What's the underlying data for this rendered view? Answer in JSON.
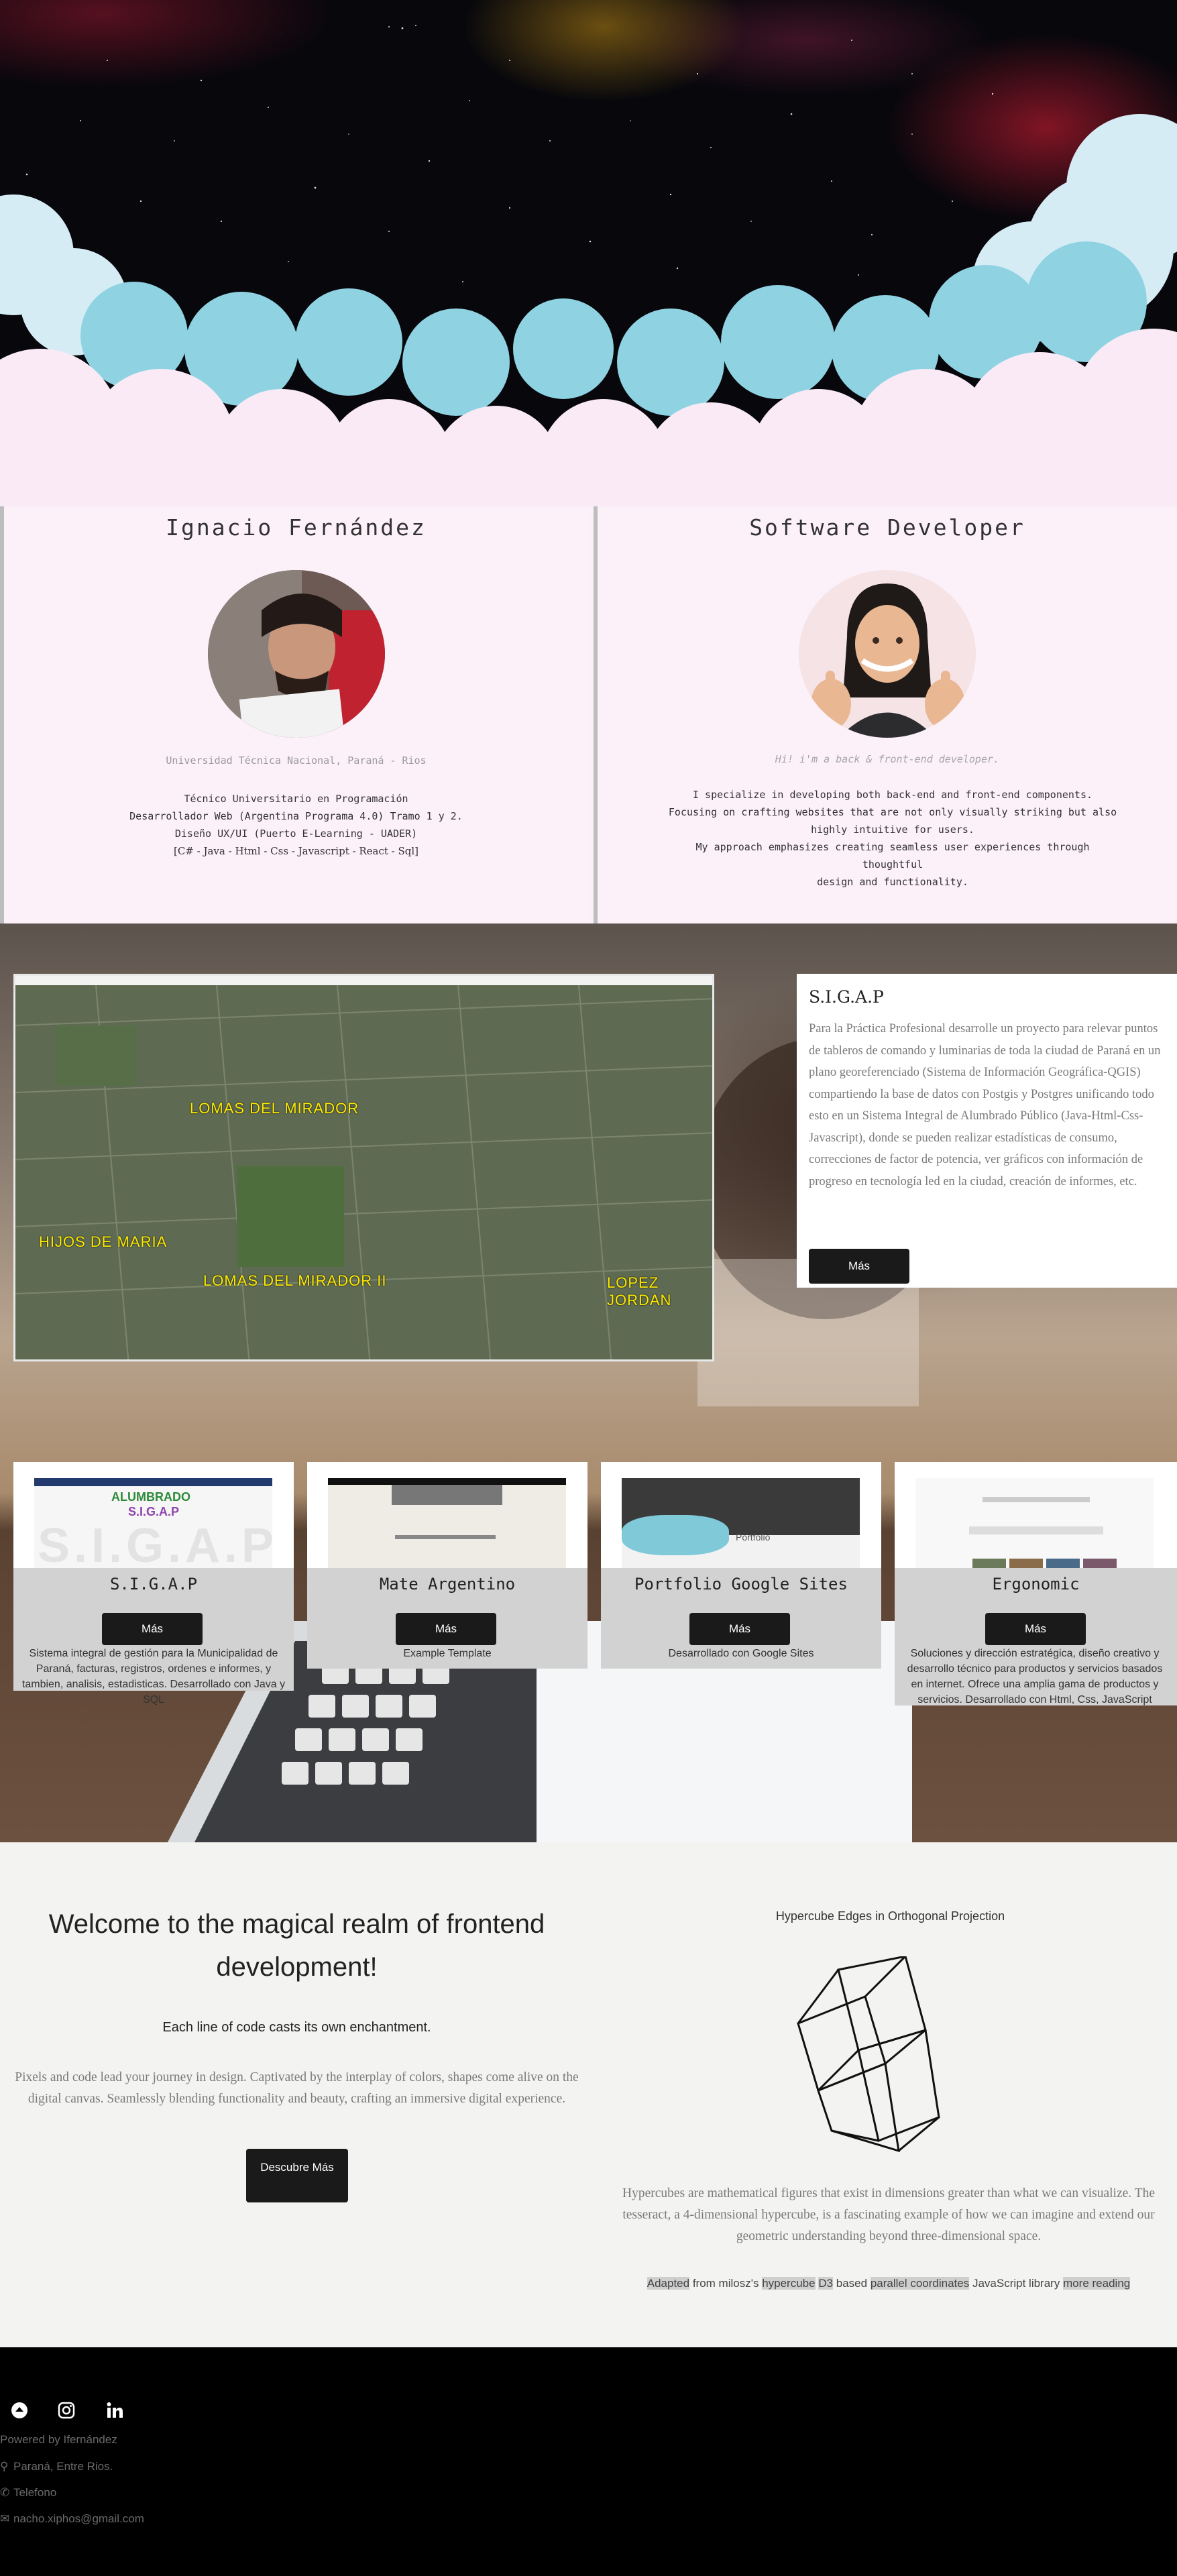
{
  "profile": {
    "name": "Ignacio Fernández",
    "university": "Universidad Técnica Nacional, Paraná - Rios",
    "credentials": [
      "Técnico Universitario en Programación",
      "Desarrollador Web (Argentina Programa 4.0) Tramo 1 y 2.",
      "Diseño UX/UI (Puerto E-Learning - UADER)"
    ],
    "stack": "[C# - Java - Html - Css - Javascript - React - Sql]"
  },
  "role": {
    "title": "Software Developer",
    "greeting": "Hi! i'm a back & front-end developer.",
    "description_lines": [
      "I specialize in developing both back-end and front-end components.",
      "Focusing on crafting websites that are not only visually striking but also",
      "highly intuitive for users.",
      "My approach emphasizes creating seamless user experiences through thoughtful",
      "design and functionality."
    ]
  },
  "featured": {
    "title": "S.I.G.A.P",
    "description": "Para la Práctica Profesional desarrolle un proyecto para relevar puntos de tableros de comando y luminarias de toda la ciudad de Paraná en un plano georeferenciado (Sistema de Información Geográfica-QGIS) compartiendo la base de datos con Postgis y Postgres unificando todo esto en un Sistema Integral de Alumbrado Público (Java-Html-Css-Javascript), donde se pueden realizar estadísticas de consumo, correcciones de factor de potencia, ver gráficos con información de progreso en tecnología led en la ciudad, creación de informes, etc.",
    "button": "Más",
    "map_labels": [
      "LOMAS DEL MIRADOR",
      "HIJOS DE MARIA",
      "LOMAS DEL MIRADOR II",
      "LOPEZ JORDAN"
    ]
  },
  "projects": [
    {
      "name": "S.I.G.A.P",
      "button": "Más",
      "desc": "Sistema integral de gestión para la Municipalidad de Paraná, facturas, registros, ordenes e informes, y tambien, analisis, estadisticas. Desarrollado con Java y SQL"
    },
    {
      "name": "Mate Argentino",
      "button": "Más",
      "desc": "Example Template"
    },
    {
      "name": "Portfolio Google Sites",
      "button": "Más",
      "desc": "Desarrollado con Google Sites"
    },
    {
      "name": "Ergonomic",
      "button": "Más",
      "desc": "Soluciones y dirección estratégica, diseño creativo y desarrollo técnico para productos y servicios basados en internet. Ofrece una amplia gama de productos y servicios. Desarrollado con Html, Css, JavaScript"
    }
  ],
  "thumbs": {
    "sigap_logo_top": "ALUMBRADO",
    "sigap_logo_bottom": "S.I.G.A.P",
    "sigap_watermark": "S.I.G.A.P",
    "portfolio_word": "Portfolio"
  },
  "frontend": {
    "heading": "Welcome to the magical realm of frontend development!",
    "subheading": "Each line of code casts its own enchantment.",
    "paragraph": "Pixels and code lead your journey in design. Captivated by the interplay of colors, shapes come alive on the digital canvas. Seamlessly blending functionality and beauty, crafting an immersive digital experience.",
    "button": "Descubre Más"
  },
  "hypercube": {
    "title": "Hypercube Edges in Orthogonal Projection",
    "paragraph": "Hypercubes are mathematical figures that exist in dimensions greater than what we can visualize. The tesseract, a 4-dimensional hypercube, is a fascinating example of how we can imagine and extend our geometric understanding beyond three-dimensional space.",
    "credit": {
      "adapted": "Adapted",
      "from": " from milosz's ",
      "hypercube": "hypercube",
      "d3": "D3",
      "based": " based ",
      "parallel": "parallel coordinates",
      "library": " JavaScript library ",
      "more": "more reading"
    }
  },
  "footer": {
    "powered": "Powered by Ifernández",
    "location": "Paraná, Entre Rios.",
    "phone": "Telefono",
    "email": "nacho.xiphos@gmail.com",
    "icons": [
      "circle-logo-icon",
      "instagram-icon",
      "linkedin-icon"
    ]
  },
  "colors": {
    "accent_dark": "#1a1a1a",
    "card_gray": "#d2d2d2",
    "profile_bg": "#fcf0f9",
    "map_label": "#ffea00"
  }
}
